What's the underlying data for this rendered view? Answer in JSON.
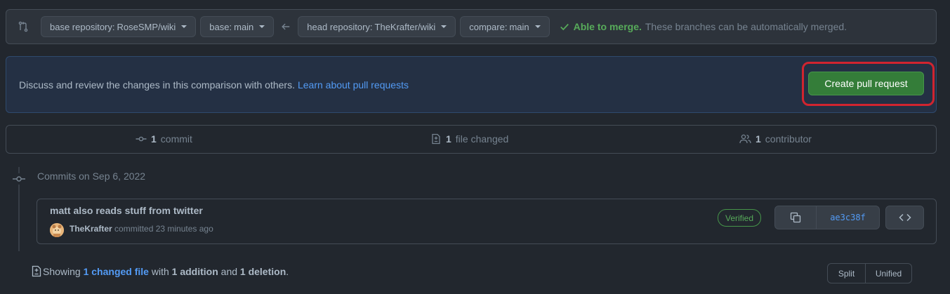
{
  "range": {
    "base_repo_label": "base repository:",
    "base_repo_value": "RoseSMP/wiki",
    "base_label": "base:",
    "base_value": "main",
    "head_repo_label": "head repository:",
    "head_repo_value": "TheKrafter/wiki",
    "compare_label": "compare:",
    "compare_value": "main",
    "merge_status": "Able to merge.",
    "merge_desc": "These branches can be automatically merged."
  },
  "banner": {
    "text": "Discuss and review the changes in this comparison with others.",
    "link": "Learn about pull requests",
    "create_button": "Create pull request"
  },
  "stats": {
    "commits_count": "1",
    "commits_label": "commit",
    "files_count": "1",
    "files_label": "file changed",
    "contributors_count": "1",
    "contributors_label": "contributor"
  },
  "timeline": {
    "date_heading": "Commits on Sep 6, 2022",
    "commit": {
      "message": "matt also reads stuff from twitter",
      "author": "TheKrafter",
      "action": "committed 23 minutes ago",
      "verified": "Verified",
      "sha": "ae3c38f"
    }
  },
  "summary": {
    "prefix": "Showing",
    "changed": "1 changed file",
    "with": "with",
    "additions": "1 addition",
    "and": "and",
    "deletions": "1 deletion",
    "period": "."
  },
  "view": {
    "split": "Split",
    "unified": "Unified"
  },
  "colors": {
    "background": "#22272e",
    "success": "#57ab5a",
    "link": "#539bf5",
    "create_button": "#347d39",
    "highlight": "#d1242f"
  },
  "icons": [
    "git-compare-icon",
    "arrow-left-icon",
    "check-icon",
    "git-commit-icon",
    "file-diff-icon",
    "people-icon",
    "copy-icon",
    "code-icon"
  ]
}
